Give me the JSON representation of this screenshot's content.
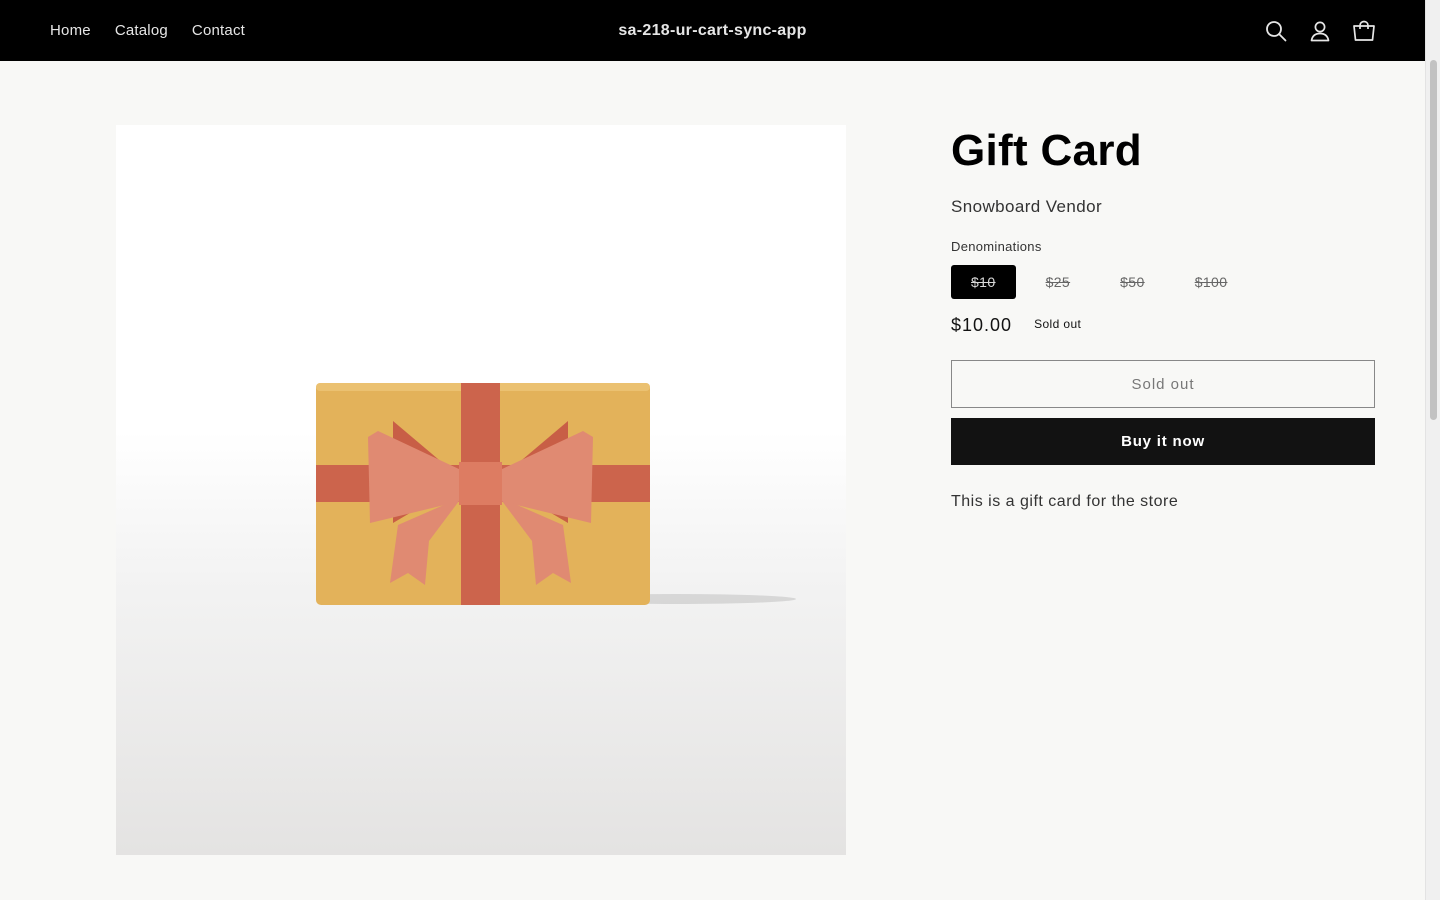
{
  "header": {
    "nav": [
      "Home",
      "Catalog",
      "Contact"
    ],
    "brand": "sa-218-ur-cart-sync-app",
    "icons": [
      "search-icon",
      "account-icon",
      "cart-icon"
    ],
    "background": "#000000"
  },
  "product": {
    "title": "Gift Card",
    "vendor": "Snowboard Vendor",
    "option_label": "Denominations",
    "options": [
      "$10",
      "$25",
      "$50",
      "$100"
    ],
    "selected_option": "$10",
    "price": "$10.00",
    "badge": "Sold out",
    "sold_out_button": "Sold out",
    "buy_button": "Buy it now",
    "description": "This is a gift card for the store",
    "image_icon": "gift-card-illustration",
    "image_colors": {
      "card": "#e3b25a",
      "ribbon": "#cc644c",
      "bow": "#e08a72"
    }
  }
}
